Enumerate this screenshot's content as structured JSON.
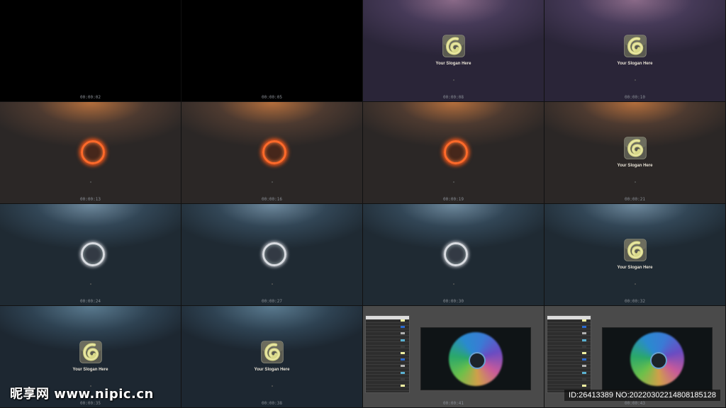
{
  "slogan": "Your Slogan Here",
  "frames": [
    {
      "time": "00:00:02",
      "bg": "black",
      "content": "none"
    },
    {
      "time": "00:00:05",
      "bg": "black",
      "content": "none"
    },
    {
      "time": "00:00:08",
      "bg": "purple",
      "content": "logo"
    },
    {
      "time": "00:00:10",
      "bg": "purple",
      "content": "logo"
    },
    {
      "time": "00:00:13",
      "bg": "orange",
      "content": "ring-orange"
    },
    {
      "time": "00:00:16",
      "bg": "orange",
      "content": "ring-orange"
    },
    {
      "time": "00:00:19",
      "bg": "orange",
      "content": "ring-orange"
    },
    {
      "time": "00:00:21",
      "bg": "orange",
      "content": "logo"
    },
    {
      "time": "00:00:24",
      "bg": "steel",
      "content": "ring-silver"
    },
    {
      "time": "00:00:27",
      "bg": "steel",
      "content": "ring-silver"
    },
    {
      "time": "00:00:30",
      "bg": "steel",
      "content": "ring-silver"
    },
    {
      "time": "00:00:32",
      "bg": "steel",
      "content": "logo"
    },
    {
      "time": "00:00:35",
      "bg": "blue",
      "content": "logo"
    },
    {
      "time": "00:00:38",
      "bg": "blue",
      "content": "logo"
    },
    {
      "time": "00:00:41",
      "bg": "gray",
      "content": "editor"
    },
    {
      "time": "00:00:43",
      "bg": "gray",
      "content": "editor"
    }
  ],
  "watermark_left": "昵享网 www.nipic.cn",
  "watermark_right": "ID:26413389 NO:20220302214808185128",
  "colors": {
    "logo_yellow": "#d9d98a",
    "ring_orange": "#ff6a2a",
    "ring_silver": "#d8dbe0"
  }
}
